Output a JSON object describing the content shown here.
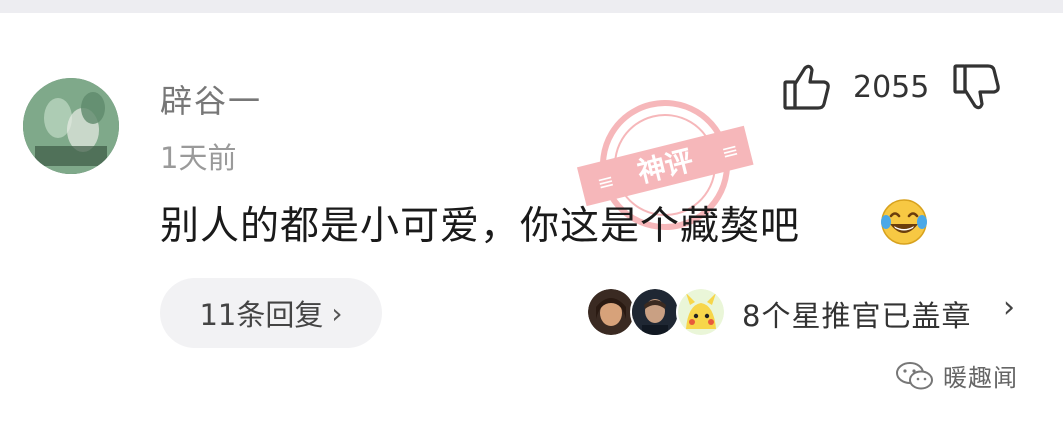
{
  "comment": {
    "username": "辟谷一",
    "timestamp": "1天前",
    "text": "别人的都是小可爱，你这是个藏獒吧",
    "like_count": "2055",
    "emoji_icon": "laughing-tears-emoji"
  },
  "replies": {
    "label": "11条回复",
    "chevron": "›"
  },
  "stars": {
    "label": "8个星推官已盖章",
    "chevron": "›"
  },
  "stamp": {
    "text": "神评"
  },
  "watermark": {
    "text": "暖趣闻",
    "icon": "wechat-icon"
  },
  "colors": {
    "stamp_red": "#e8454b",
    "emoji_yellow": "#f7c843",
    "pill_bg": "#f2f2f4"
  }
}
